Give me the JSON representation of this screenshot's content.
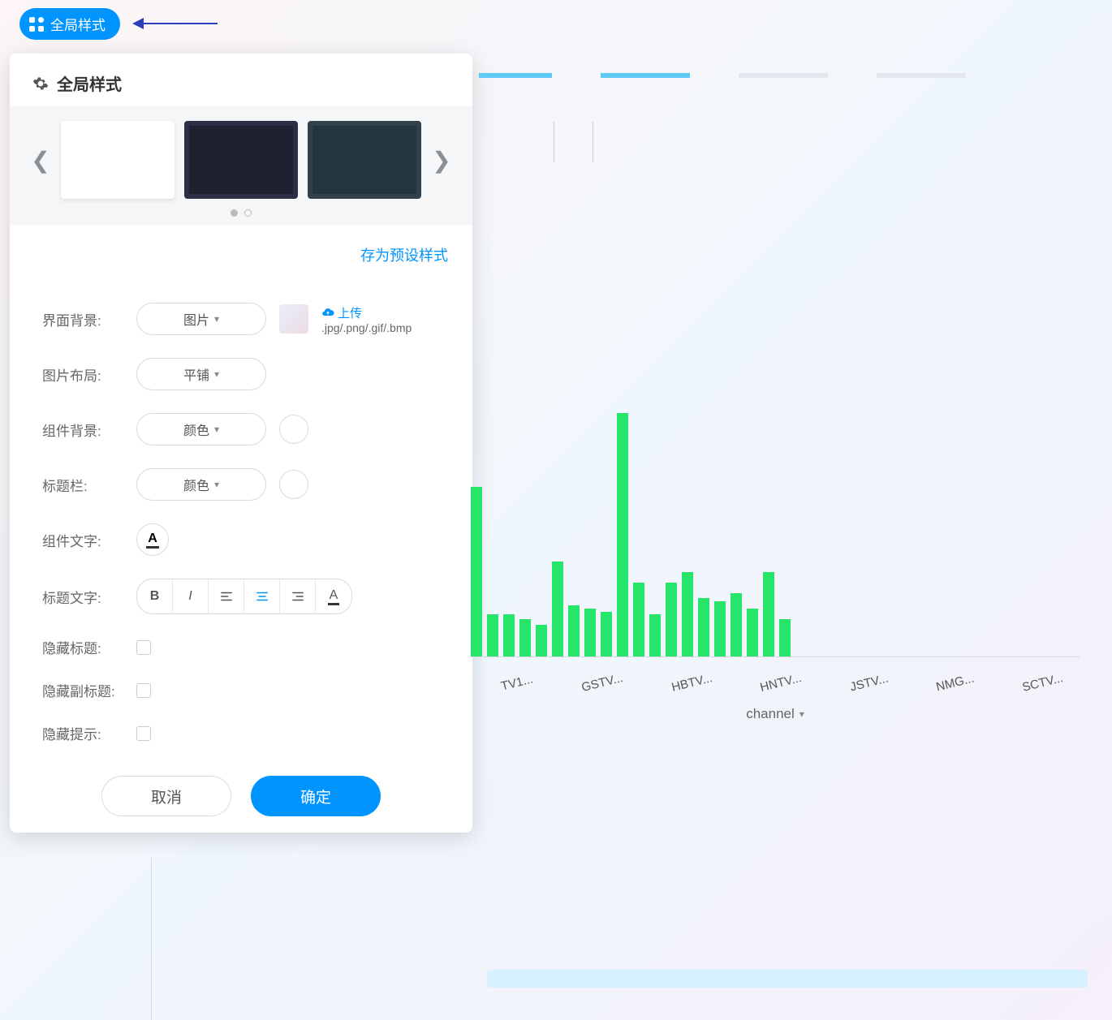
{
  "top_button": {
    "label": "全局样式"
  },
  "panel": {
    "title": "全局样式",
    "save_preset": "存为预设样式",
    "labels": {
      "bg": "界面背景:",
      "img_layout": "图片布局:",
      "comp_bg": "组件背景:",
      "title_bar": "标题栏:",
      "comp_text": "组件文字:",
      "title_text": "标题文字:",
      "hide_title": "隐藏标题:",
      "hide_subtitle": "隐藏副标题:",
      "hide_tip": "隐藏提示:"
    },
    "values": {
      "bg": "图片",
      "img_layout": "平铺",
      "comp_bg": "颜色",
      "title_bar": "颜色"
    },
    "upload": {
      "text": "上传",
      "hint": ".jpg/.png/.gif/.bmp"
    },
    "buttons": {
      "cancel": "取消",
      "ok": "确定"
    },
    "format_letters": {
      "bold": "B",
      "italic": "I",
      "font": "A"
    }
  },
  "chart_data": {
    "type": "bar",
    "xlabel": "channel",
    "visible_categories": [
      "TV1...",
      "GSTV...",
      "HBTV...",
      "HNTV...",
      "JSTV...",
      "NMG...",
      "SCTV..."
    ],
    "values": [
      160,
      40,
      40,
      35,
      30,
      90,
      48,
      45,
      42,
      230,
      70,
      40,
      70,
      80,
      55,
      52,
      60,
      45,
      80,
      35
    ],
    "ylim": [
      0,
      230
    ],
    "color": "#27e56b"
  }
}
